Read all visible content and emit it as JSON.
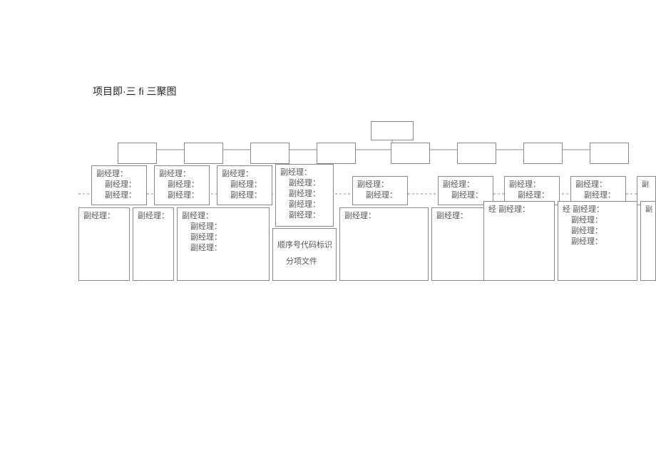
{
  "title": "项目即·三 fi 三聚图",
  "label_fjl": "副经理：",
  "label_order": "顺序号代码标识",
  "label_subfile": "分项文件"
}
